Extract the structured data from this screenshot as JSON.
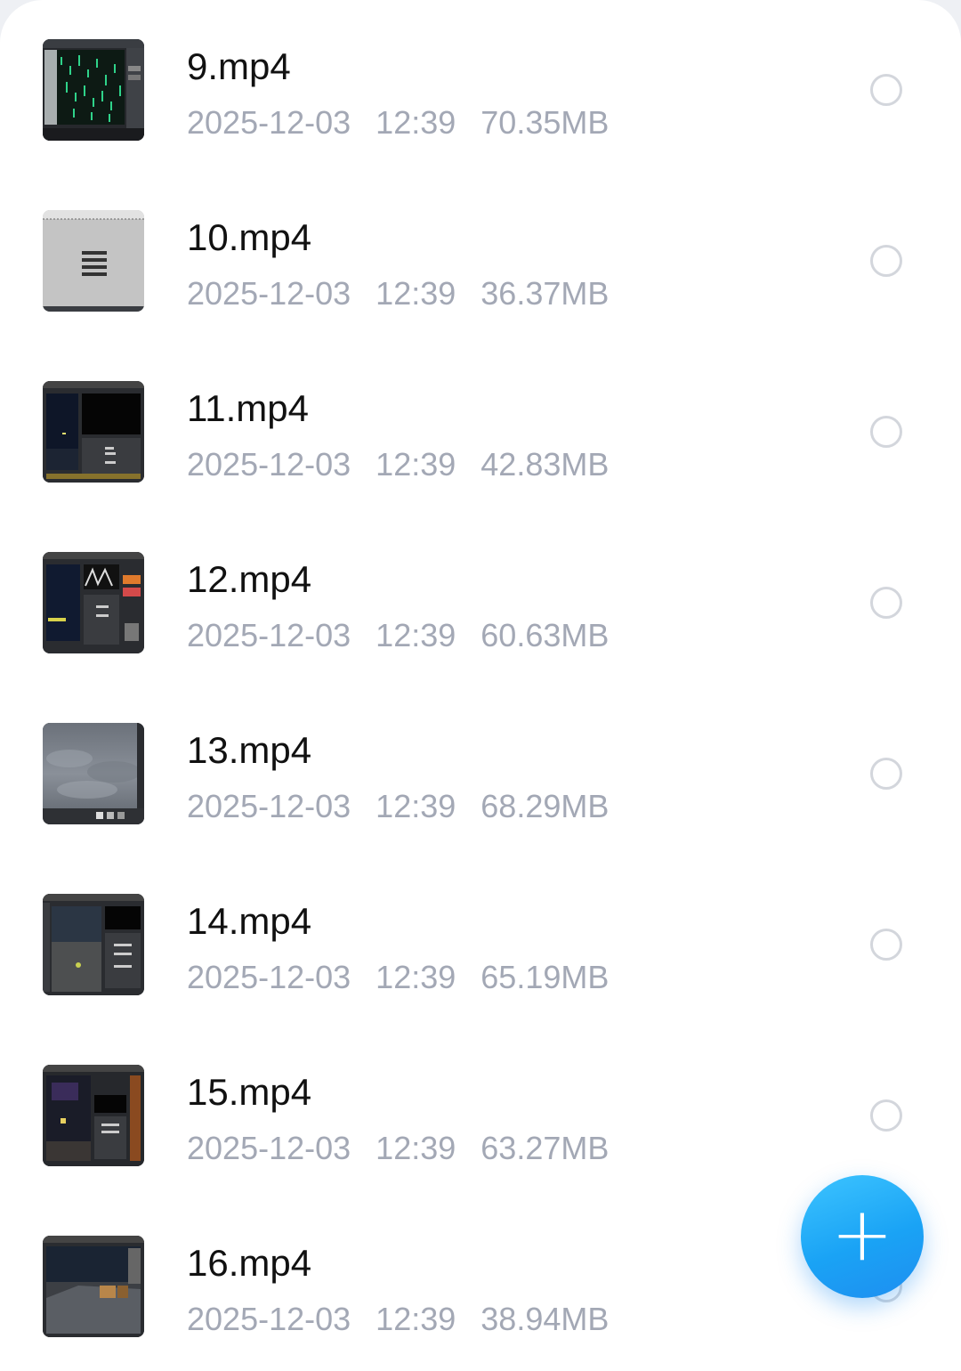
{
  "files": [
    {
      "name": "9.mp4",
      "date": "2025-12-03",
      "time": "12:39",
      "size": "70.35MB",
      "thumb": "green-particles"
    },
    {
      "name": "10.mp4",
      "date": "2025-12-03",
      "time": "12:39",
      "size": "36.37MB",
      "thumb": "gray-menu"
    },
    {
      "name": "11.mp4",
      "date": "2025-12-03",
      "time": "12:39",
      "size": "42.83MB",
      "thumb": "editor-dark"
    },
    {
      "name": "12.mp4",
      "date": "2025-12-03",
      "time": "12:39",
      "size": "60.63MB",
      "thumb": "editor-dark-orange"
    },
    {
      "name": "13.mp4",
      "date": "2025-12-03",
      "time": "12:39",
      "size": "68.29MB",
      "thumb": "cloudy-sky"
    },
    {
      "name": "14.mp4",
      "date": "2025-12-03",
      "time": "12:39",
      "size": "65.19MB",
      "thumb": "editor-terrain"
    },
    {
      "name": "15.mp4",
      "date": "2025-12-03",
      "time": "12:39",
      "size": "63.27MB",
      "thumb": "editor-night"
    },
    {
      "name": "16.mp4",
      "date": "2025-12-03",
      "time": "12:39",
      "size": "38.94MB",
      "thumb": "scene-room"
    }
  ],
  "fab": {
    "icon": "plus-icon",
    "label": "+"
  },
  "colors": {
    "fab": "#1aa3f5",
    "meta_text": "#a3a8b5",
    "name_text": "#111111"
  }
}
